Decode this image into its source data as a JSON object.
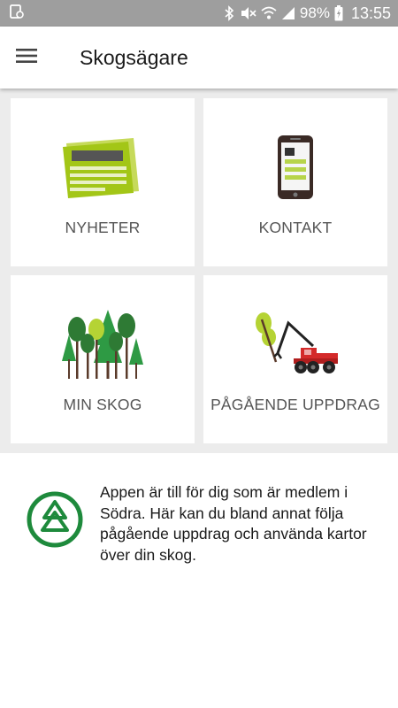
{
  "statusbar": {
    "battery_percent": "98%",
    "time": "13:55"
  },
  "appbar": {
    "title": "Skogsägare"
  },
  "tiles": [
    {
      "label": "NYHETER",
      "icon": "newspaper-icon"
    },
    {
      "label": "KONTAKT",
      "icon": "mobile-phone-icon"
    },
    {
      "label": "MIN SKOG",
      "icon": "forest-icon"
    },
    {
      "label": "PÅGÅENDE UPPDRAG",
      "icon": "harvester-icon"
    }
  ],
  "info": {
    "text": "Appen är till för dig som är medlem i Södra. Här kan du bland annat följa pågående uppdrag och använda kartor över din skog.",
    "logo": "sodra-logo"
  },
  "colors": {
    "accent_green": "#a3c617",
    "brand_green": "#1e8a3c",
    "tile_text": "#555555",
    "harvester_red": "#d42a2a"
  }
}
